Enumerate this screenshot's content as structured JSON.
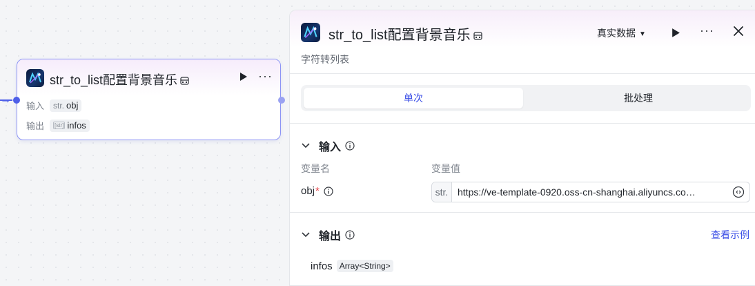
{
  "node": {
    "title": "str_to_list配置背景音乐",
    "inputs_label": "输入",
    "outputs_label": "输出",
    "input_type": "str.",
    "input_name": "obj",
    "output_type": "[str]",
    "output_name": "infos"
  },
  "panel": {
    "title": "str_to_list配置背景音乐",
    "description": "字符转列表",
    "data_mode": "真实数据",
    "tabs": [
      "单次",
      "批处理"
    ],
    "input_section": {
      "title": "输入",
      "col_name": "变量名",
      "col_value": "变量值",
      "var_name": "obj",
      "required_mark": "*",
      "type_tag": "str.",
      "value": "https://ve-template-0920.oss-cn-shanghai.aliyuncs.co…"
    },
    "output_section": {
      "title": "输出",
      "example_link": "查看示例",
      "item_name": "infos",
      "item_type": "Array<String>"
    }
  },
  "colors": {
    "accent": "#3b4ee6",
    "edge": "#4e5fe8",
    "required": "#e5484d"
  },
  "icons": [
    "app-logo-icon",
    "database-icon",
    "play-icon",
    "more-icon",
    "close-icon",
    "chevron-down-icon",
    "info-icon",
    "expand-icon",
    "arrow-right-icon"
  ]
}
